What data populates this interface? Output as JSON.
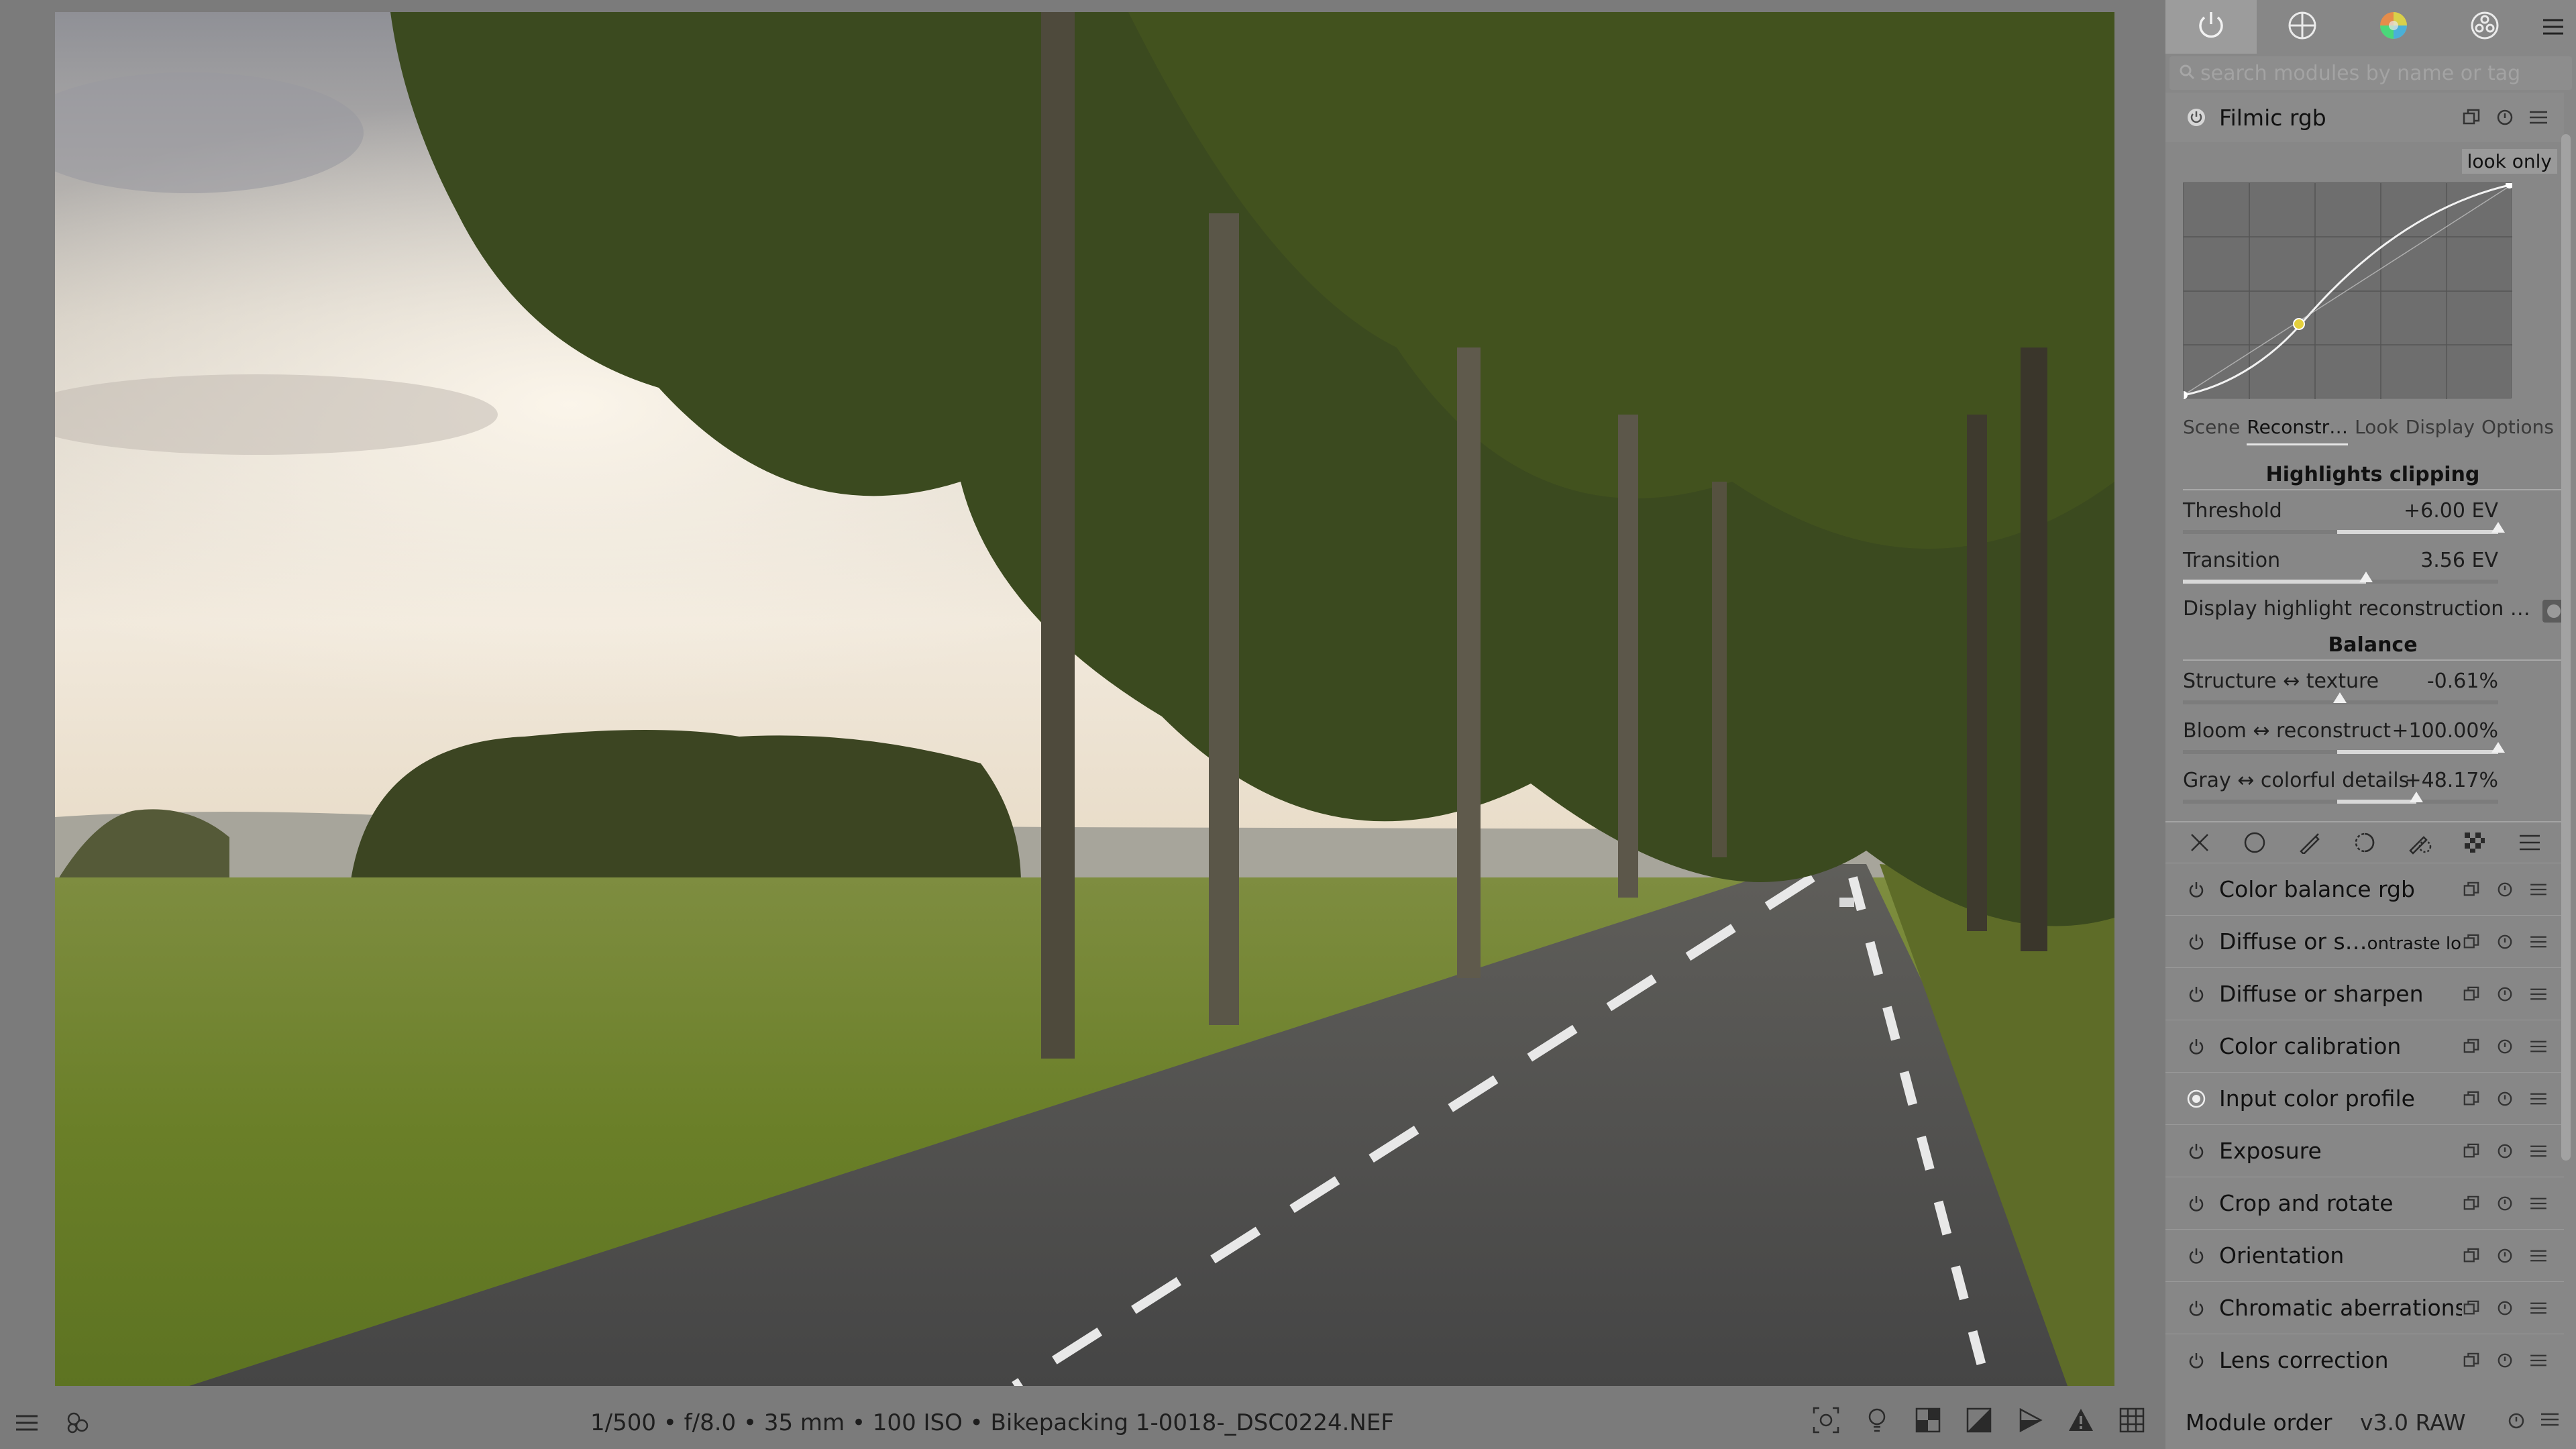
{
  "app": {
    "image_info": "1/500 • f/8.0 • 35 mm • 100 ISO • Bikepacking 1-0018-_DSC0224.NEF"
  },
  "tabs": [
    {
      "icon": "power-icon",
      "active": true
    },
    {
      "icon": "base-icon",
      "active": false
    },
    {
      "icon": "color-wheel-icon",
      "active": false
    },
    {
      "icon": "effects-icon",
      "active": false
    }
  ],
  "search": {
    "placeholder": "search modules by name or tag"
  },
  "filmic": {
    "title": "Filmic rgb",
    "look_only": "look only",
    "subtabs": [
      "Scene",
      "Reconstr…",
      "Look",
      "Display",
      "Options"
    ],
    "active_subtab": "Reconstr…",
    "section_highlights": "Highlights clipping",
    "sliders": [
      {
        "label": "Threshold",
        "value": "+6.00 EV",
        "fraction": 1.0,
        "knee": true
      },
      {
        "label": "Transition",
        "value": "3.56 EV",
        "fraction": 0.58,
        "knee": false
      }
    ],
    "checkbox_label": "Display highlight reconstruction …",
    "section_balance": "Balance",
    "balance_sliders": [
      {
        "label": "Structure ↔ texture",
        "value": "-0.61%",
        "fraction": 0.5,
        "centered": true
      },
      {
        "label": "Bloom ↔ reconstruct",
        "value": "+100.00%",
        "fraction": 1.0,
        "centered": true
      },
      {
        "label": "Gray ↔ colorful details",
        "value": "+48.17%",
        "fraction": 0.74,
        "centered": true
      }
    ]
  },
  "modules": [
    {
      "name": "Color balance rgb",
      "on": false
    },
    {
      "name": "Diffuse or s…",
      "suffix": "ontraste local",
      "on": false
    },
    {
      "name": "Diffuse or sharpen",
      "on": false
    },
    {
      "name": "Color calibration",
      "on": false
    },
    {
      "name": "Input color profile",
      "on": true
    },
    {
      "name": "Exposure",
      "on": false
    },
    {
      "name": "Crop and rotate",
      "on": false
    },
    {
      "name": "Orientation",
      "on": false
    },
    {
      "name": "Chromatic aberrations",
      "on": false
    },
    {
      "name": "Lens correction",
      "on": false
    }
  ],
  "panel_bottom": {
    "module_order_label": "Module order",
    "version": "v3.0 RAW"
  },
  "colors": {
    "panel_bg": "#878787",
    "sky": "#e9e4d6",
    "grass": "#6f8a2c",
    "road": "#4a4a4a",
    "foliage": "#3e4a22"
  }
}
